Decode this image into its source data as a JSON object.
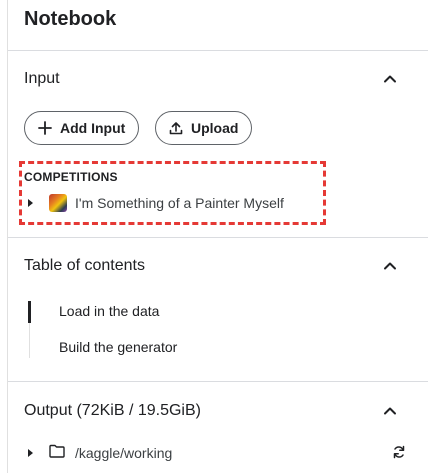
{
  "panel": {
    "title": "Notebook"
  },
  "input": {
    "heading": "Input",
    "add_label": "Add Input",
    "upload_label": "Upload",
    "competitions_label": "COMPETITIONS",
    "competition_name": "I'm Something of a Painter Myself"
  },
  "toc": {
    "heading": "Table of contents",
    "items": [
      "Load in the data",
      "Build the generator"
    ],
    "active_index": 0
  },
  "output": {
    "heading": "Output (72KiB / 19.5GiB)",
    "path": "/kaggle/working"
  },
  "icons": {
    "collapse": "chevron-up-icon",
    "add": "plus-icon",
    "upload": "upload-icon",
    "expand": "caret-right-icon",
    "folder": "folder-icon",
    "refresh": "refresh-icon"
  },
  "colors": {
    "highlight": "#e53935",
    "text": "#202124",
    "divider": "#dadce0"
  }
}
